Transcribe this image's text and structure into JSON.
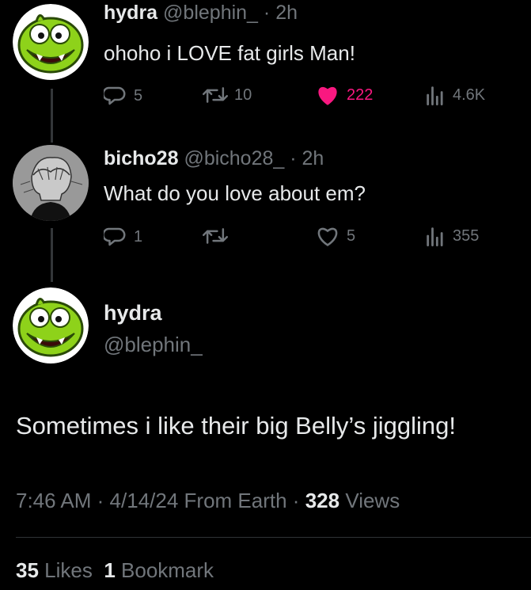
{
  "tweet1": {
    "name": "hydra",
    "handle": "@blephin_",
    "sep": "·",
    "time": "2h",
    "text": "ohoho i LOVE fat girls Man!",
    "replies": "5",
    "retweets": "10",
    "likes": "222",
    "views": "4.6K"
  },
  "tweet2": {
    "name": "bicho28",
    "handle": "@bicho28_",
    "sep": "·",
    "time": "2h",
    "text": "What do you love about em?",
    "replies": "1",
    "retweets": "",
    "likes": "5",
    "views": "355"
  },
  "main": {
    "name": "hydra",
    "handle": "@blephin_",
    "text": "Sometimes i like their big Belly’s jiggling!",
    "time": "7:46 AM",
    "sep": "·",
    "date": "4/14/24",
    "source": "From Earth",
    "sep2": "·",
    "views_count": "328",
    "views_label": "Views",
    "likes_count": "35",
    "likes_label": "Likes",
    "bookmarks_count": "1",
    "bookmarks_label": "Bookmark"
  },
  "colors": {
    "background": "#000000",
    "text_primary": "#e7e9ea",
    "text_secondary": "#71767b",
    "like_active": "#f91880",
    "avatar_green": "#8ed21a"
  },
  "icons": [
    "reply-icon",
    "retweet-icon",
    "like-icon",
    "views-icon"
  ]
}
